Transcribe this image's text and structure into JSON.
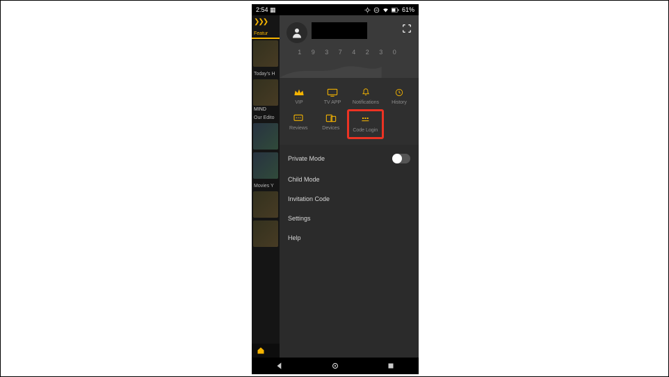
{
  "status": {
    "time": "2:54",
    "battery": "61%"
  },
  "bg": {
    "tab": "Featur",
    "sec1": "Today's H",
    "sec2": "Our Edito",
    "sec3": "Movies Y",
    "mind": "MIND"
  },
  "profile": {
    "counter": "1 9 3 7 4 2 3 0"
  },
  "shortcuts": {
    "row1": [
      {
        "label": "VIP"
      },
      {
        "label": "TV APP"
      },
      {
        "label": "Notifications"
      },
      {
        "label": "History"
      }
    ],
    "row2": [
      {
        "label": "Reviews"
      },
      {
        "label": "Devices"
      },
      {
        "label": "Code Login"
      }
    ]
  },
  "menu": {
    "privateMode": "Private Mode",
    "childMode": "Child Mode",
    "invitation": "Invitation Code",
    "settings": "Settings",
    "help": "Help"
  }
}
